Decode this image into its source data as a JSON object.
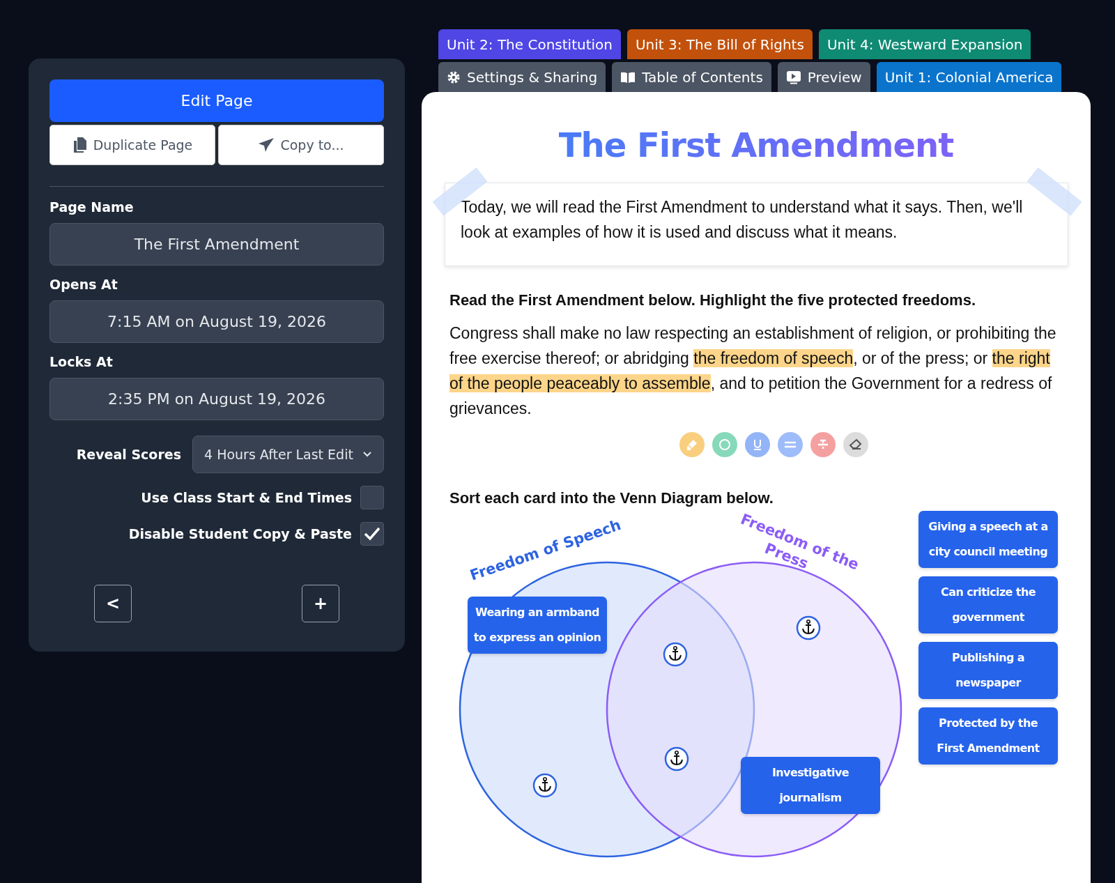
{
  "panel": {
    "edit_button": "Edit Page",
    "duplicate_button": "Duplicate Page",
    "copy_button": "Copy to...",
    "fields": [
      {
        "label": "Page Name",
        "value": "The First Amendment"
      },
      {
        "label": "Opens At",
        "value": "7:15 AM on August 19, 2026"
      },
      {
        "label": "Locks At",
        "value": "2:35 PM on August 19, 2026"
      }
    ],
    "reveal_scores": {
      "label": "Reveal Scores",
      "value": "4 Hours After Last Edit"
    },
    "checkboxes": [
      {
        "label": "Use Class Start & End Times",
        "checked": false
      },
      {
        "label": "Disable Student Copy & Paste",
        "checked": true
      }
    ],
    "nav_buttons": [
      "<",
      "+"
    ]
  },
  "tabs": [
    [
      {
        "label": "Unit 2: The Constitution",
        "color": "#4f46e5",
        "kind": "unit"
      },
      {
        "label": "Unit 3: The Bill of Rights",
        "color": "#c2510c",
        "kind": "unit"
      },
      {
        "label": "Unit 4: Westward Expansion",
        "color": "#0f8a73",
        "kind": "unit"
      }
    ],
    [
      {
        "label": "Settings & Sharing",
        "color": "#4b5563",
        "kind": "settings"
      },
      {
        "label": "Table of Contents",
        "color": "#4b5563",
        "kind": "contents"
      },
      {
        "label": "Preview",
        "color": "#4b5563",
        "kind": "preview"
      },
      {
        "label": "Unit 1: Colonial America",
        "color": "#0a74cc",
        "kind": "unit"
      }
    ]
  ],
  "page": {
    "title": "The First Amendment",
    "intro": "Today, we will read the First Amendment to understand what it says. Then, we'll look at examples of how it is used and discuss what it means.",
    "instruction": "Read the First Amendment below. Highlight the five protected freedoms.",
    "passage": [
      {
        "text": "Congress shall make no law respecting an establishment of religion, or prohibiting the free exercise thereof; or abridging ",
        "highlighted": false
      },
      {
        "text": "the freedom of speech",
        "highlighted": true
      },
      {
        "text": ", or of the press; or ",
        "highlighted": false
      },
      {
        "text": "the right of the people peaceably to assemble",
        "highlighted": true
      },
      {
        "text": ", and to petition the Government for a redress of grievances.",
        "highlighted": false
      }
    ],
    "sort_instruction": "Sort each card into the Venn Diagram below.",
    "venn": {
      "left_label": "Freedom of Speech",
      "right_label_lines": [
        "Freedom of the",
        "Press"
      ],
      "placed_cards": [
        "Wearing an armband to express an opinion",
        "Investigative journalism"
      ],
      "bank_cards": [
        "Giving a speech at a city council meeting",
        "Can criticize the government",
        "Publishing a newspaper",
        "Protected by the First Amendment"
      ]
    }
  }
}
